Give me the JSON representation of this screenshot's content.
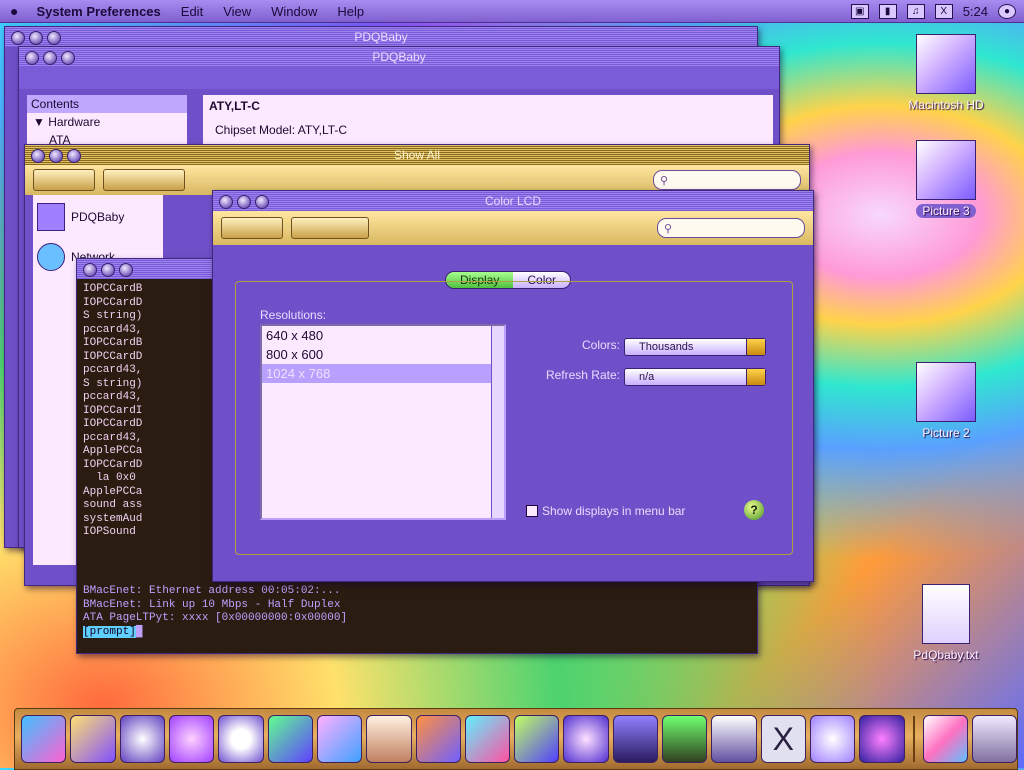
{
  "menubar": {
    "app": "System Preferences",
    "items": [
      "Edit",
      "View",
      "Window",
      "Help"
    ],
    "clock": "5:24"
  },
  "desktop": {
    "icons": [
      "Macintosh HD",
      "Picture 3",
      "Picture 2",
      "PdQbaby.txt"
    ]
  },
  "windows": {
    "sysprofiler": {
      "title": "PDQBaby",
      "subtitle": "PDQBaby",
      "sidebar_header": "Contents",
      "sidebar_items": [
        "Hardware",
        "ATA"
      ],
      "detail_title": "ATY,LT-C",
      "chipset_label": "Chipset Model:",
      "chipset_value": "ATY,LT-C"
    },
    "syspref": {
      "title": "Show All",
      "items": [
        "PDQBaby",
        "Network"
      ]
    },
    "display": {
      "title": "Color LCD",
      "tabs": [
        "Display",
        "Color"
      ],
      "resolutions_label": "Resolutions:",
      "resolutions": [
        "640 x 480",
        "800 x 600",
        "1024 x 768"
      ],
      "selected_resolution": "1024 x 768",
      "colors_label": "Colors:",
      "colors_value": "Thousands",
      "refresh_label": "Refresh Rate:",
      "refresh_value": "n/a",
      "show_menu_label": "Show displays in menu bar",
      "help": "?"
    },
    "terminal": {
      "lines": [
        "IOPCCardB",
        "IOPCCardD",
        "S string)",
        "pccard43,",
        "IOPCCardB",
        "IOPCCardD",
        "pccard43,",
        "S string)",
        "pccard43,",
        "IOPCCardI",
        "IOPCCardD",
        "pccard43,",
        "ApplePCCa",
        "IOPCCardD",
        "  la 0x0",
        "ApplePCCa",
        "sound ass",
        "systemAud",
        "IOPSound"
      ],
      "bottom_lines": [
        "BMacEnet: Ethernet address 00:05:02:...",
        "BMacEnet: Link up 10 Mbps - Half Duplex",
        "ATA PageLTPyt: xxxx [0x00000000:0x00000]",
        "[prompt]"
      ]
    }
  }
}
